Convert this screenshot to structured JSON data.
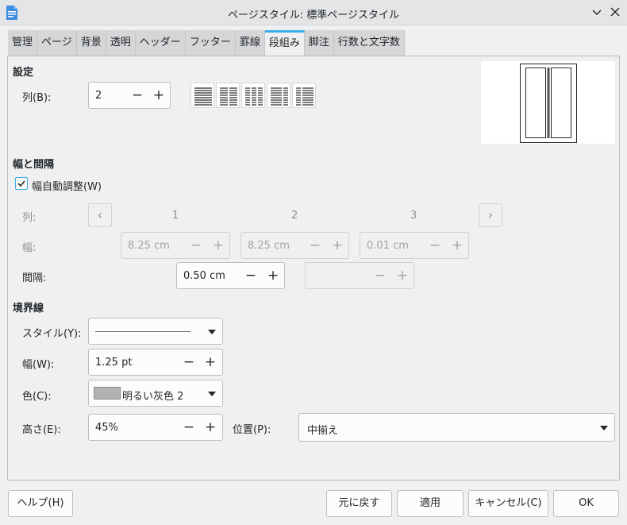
{
  "window": {
    "title": "ページスタイル: 標準ページスタイル"
  },
  "tabs": [
    "管理",
    "ページ",
    "背景",
    "透明",
    "ヘッダー",
    "フッター",
    "罫線",
    "段組み",
    "脚注",
    "行数と文字数"
  ],
  "active_tab": "段組み",
  "settings": {
    "title": "設定",
    "columns_label": "列(B):",
    "columns_value": "2"
  },
  "width_spacing": {
    "title": "幅と間隔",
    "autowidth_label": "幅自動調整(W)",
    "autowidth_checked": true,
    "column_label": "列:",
    "column_numbers": [
      "1",
      "2",
      "3"
    ],
    "width_label": "幅:",
    "widths": [
      "8.25 cm",
      "8.25 cm",
      "0.01 cm"
    ],
    "spacing_label": "間隔:",
    "spacing_value": "0.50 cm"
  },
  "separator": {
    "title": "境界線",
    "style_label": "スタイル(Y):",
    "width_label": "幅(W):",
    "width_value": "1.25 pt",
    "color_label": "色(C):",
    "color_value": "明るい灰色 2",
    "color_swatch": "#b2b2b2",
    "height_label": "高さ(E):",
    "height_value": "45%",
    "position_label": "位置(P):",
    "position_value": "中揃え"
  },
  "buttons": {
    "help": "ヘルプ(H)",
    "reset": "元に戻す",
    "apply": "適用",
    "cancel": "キャンセル(C)",
    "ok": "OK"
  },
  "accent_color": "#3daee9"
}
